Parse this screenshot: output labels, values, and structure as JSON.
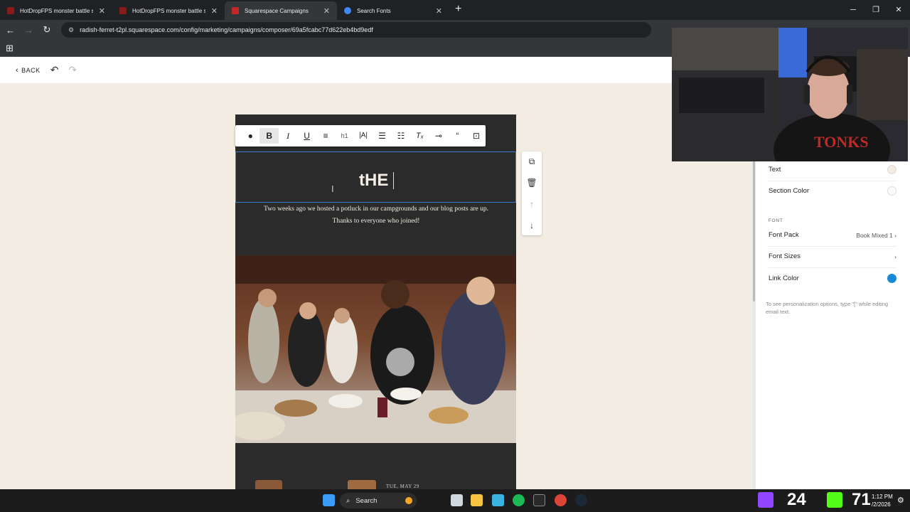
{
  "browser": {
    "tabs": [
      {
        "title": "HotDropFPS monster battle sty",
        "active": false,
        "favicon_color": "#8b1a1a"
      },
      {
        "title": "HotDropFPS monster battle sty",
        "active": false,
        "favicon_color": "#8b1a1a"
      },
      {
        "title": "Squarespace Campaigns",
        "active": true,
        "favicon_color": "#c62828"
      },
      {
        "title": "Search Fonts",
        "active": false,
        "favicon_color": "#4285f4"
      }
    ],
    "url": "radish-ferret-t2pl.squarespace.com/config/marketing/campaigns/composer/69a5fcabc77d622eb4bd9edf"
  },
  "editor": {
    "back_label": "BACK",
    "heading_text": "tHE",
    "body_text": "Two weeks ago we hosted a potluck in our campgrounds and our blog posts are up. Thanks to everyone who joined!",
    "date_text": "TUE, MAY 29",
    "toolbar": [
      "color",
      "B",
      "I",
      "U",
      "align",
      "h1",
      "|A|",
      "bullets",
      "numbers",
      "Tx",
      "link",
      "quote",
      "more"
    ]
  },
  "panel": {
    "text_label": "Text",
    "section_color_label": "Section Color",
    "font_heading": "FONT",
    "font_pack_label": "Font Pack",
    "font_pack_value": "Book Mixed 1",
    "font_sizes_label": "Font Sizes",
    "link_color_label": "Link Color",
    "link_color": "#1a8ad6",
    "hint": "To see personalization options, type \"[\" while editing email text."
  },
  "taskbar": {
    "search_label": "Search",
    "counter_a": "24",
    "counter_b": "71",
    "clock_time": "1:12 PM",
    "clock_date": "/2/2026"
  }
}
